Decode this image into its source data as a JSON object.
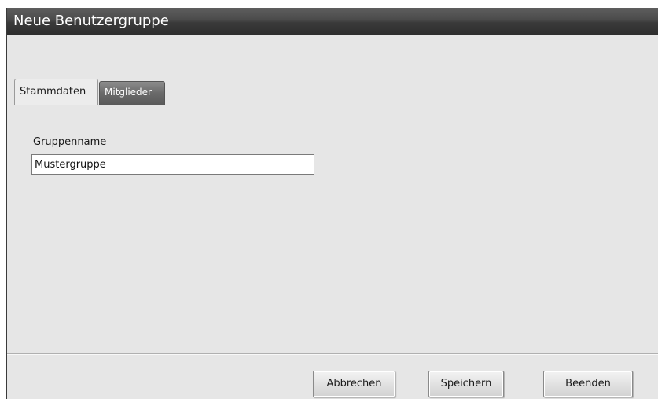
{
  "window": {
    "title": "Neue Benutzergruppe"
  },
  "tabs": [
    {
      "label": "Stammdaten",
      "active": true
    },
    {
      "label": "Mitglieder",
      "active": false
    }
  ],
  "form": {
    "group_name_label": "Gruppenname",
    "group_name_value": "Mustergruppe"
  },
  "buttons": {
    "cancel": "Abbrechen",
    "save": "Speichern",
    "exit": "Beenden"
  },
  "colors": {
    "titlebar": "#3a3a3a",
    "window_background": "#e6e6e6",
    "inactive_tab": "#6a6a6a"
  }
}
